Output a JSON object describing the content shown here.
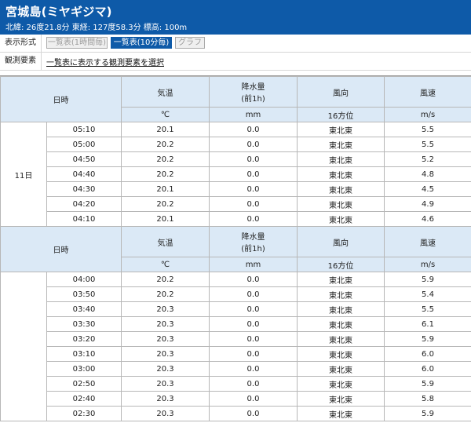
{
  "station": {
    "name": "宮城島(ミヤギジマ)",
    "meta": "北緯: 26度21.8分 東経: 127度58.3分 標高: 100m"
  },
  "controls": {
    "format_label": "表示形式",
    "buttons": [
      "一覧表(1時間毎)",
      "一覧表(10分毎)",
      "グラフ"
    ],
    "active_button": "一覧表(10分毎)",
    "elements_label": "観測要素",
    "elements_link": "一覧表に表示する観測要素を選択"
  },
  "table": {
    "headers": {
      "datetime": "日時",
      "temperature": "気温",
      "precip_line1": "降水量",
      "precip_line2": "(前1h)",
      "wind_dir": "風向",
      "wind_speed": "風速"
    },
    "units": {
      "temperature": "℃",
      "precip": "mm",
      "wind_dir": "16方位",
      "wind_speed": "m/s"
    },
    "day_label": "11日",
    "block1": [
      {
        "time": "05:10",
        "temp": "20.1",
        "precip": "0.0",
        "dir": "東北東",
        "speed": "5.5"
      },
      {
        "time": "05:00",
        "temp": "20.2",
        "precip": "0.0",
        "dir": "東北東",
        "speed": "5.5"
      },
      {
        "time": "04:50",
        "temp": "20.2",
        "precip": "0.0",
        "dir": "東北東",
        "speed": "5.2"
      },
      {
        "time": "04:40",
        "temp": "20.2",
        "precip": "0.0",
        "dir": "東北東",
        "speed": "4.8"
      },
      {
        "time": "04:30",
        "temp": "20.1",
        "precip": "0.0",
        "dir": "東北東",
        "speed": "4.5"
      },
      {
        "time": "04:20",
        "temp": "20.2",
        "precip": "0.0",
        "dir": "東北東",
        "speed": "4.9"
      },
      {
        "time": "04:10",
        "temp": "20.1",
        "precip": "0.0",
        "dir": "東北東",
        "speed": "4.6"
      }
    ],
    "block2": [
      {
        "time": "04:00",
        "temp": "20.2",
        "precip": "0.0",
        "dir": "東北東",
        "speed": "5.9"
      },
      {
        "time": "03:50",
        "temp": "20.2",
        "precip": "0.0",
        "dir": "東北東",
        "speed": "5.4"
      },
      {
        "time": "03:40",
        "temp": "20.3",
        "precip": "0.0",
        "dir": "東北東",
        "speed": "5.5"
      },
      {
        "time": "03:30",
        "temp": "20.3",
        "precip": "0.0",
        "dir": "東北東",
        "speed": "6.1"
      },
      {
        "time": "03:20",
        "temp": "20.3",
        "precip": "0.0",
        "dir": "東北東",
        "speed": "5.9"
      },
      {
        "time": "03:10",
        "temp": "20.3",
        "precip": "0.0",
        "dir": "東北東",
        "speed": "6.0"
      },
      {
        "time": "03:00",
        "temp": "20.3",
        "precip": "0.0",
        "dir": "東北東",
        "speed": "6.0"
      },
      {
        "time": "02:50",
        "temp": "20.3",
        "precip": "0.0",
        "dir": "東北東",
        "speed": "5.9"
      },
      {
        "time": "02:40",
        "temp": "20.3",
        "precip": "0.0",
        "dir": "東北東",
        "speed": "5.8"
      },
      {
        "time": "02:30",
        "temp": "20.3",
        "precip": "0.0",
        "dir": "東北東",
        "speed": "5.9"
      }
    ]
  },
  "colors": {
    "header_bg": "#0e5aa8",
    "table_header_bg": "#dbe9f6",
    "grid": "#b7b7b7"
  }
}
